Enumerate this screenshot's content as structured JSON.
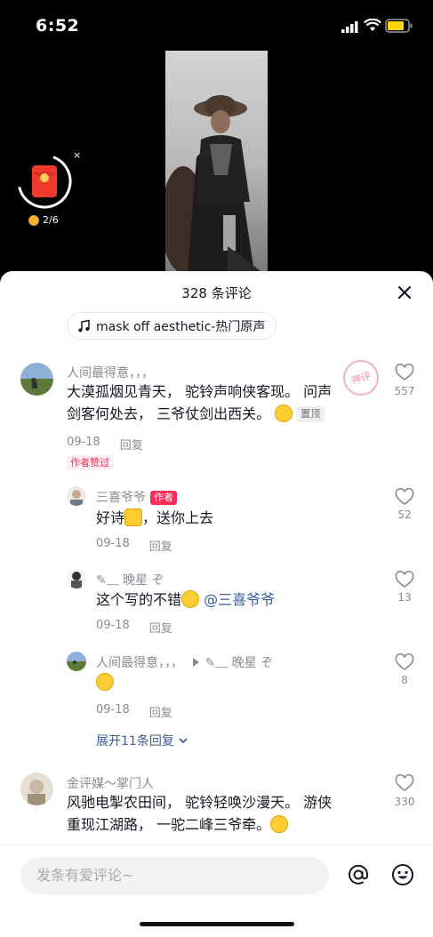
{
  "status_bar": {
    "time": "6:52"
  },
  "red_packet": {
    "count": "2/6",
    "close": "×"
  },
  "sheet": {
    "title": "328 条评论",
    "music_label": "mask off aesthetic-热门原声"
  },
  "comments": [
    {
      "user": "人间最得意，，，",
      "text_line1": "大漠孤烟见青天， 驼铃声响侠客现。 问声",
      "text_line2": "剑客何处去， 三爷仗剑出西关。",
      "pin_label": "置顶",
      "date": "09-18",
      "reply_label": "回复",
      "likes": "557",
      "author_liked": "作者赞过",
      "stamp": "神评"
    },
    {
      "user": "三喜爷爷",
      "author_tag": "作者",
      "text": "好诗",
      "text_after": "，送你上去",
      "date": "09-18",
      "reply_label": "回复",
      "likes": "52"
    },
    {
      "user": "✎﹏ 晚星 ぞ",
      "text": "这个写的不错",
      "mention": "@三喜爷爷",
      "date": "09-18",
      "reply_label": "回复",
      "likes": "13"
    },
    {
      "user": "人间最得意，，，",
      "reply_to": "✎﹏ 晚星 ぞ",
      "date": "09-18",
      "reply_label": "回复",
      "likes": "8"
    },
    {
      "user": "金评媒～掌门人",
      "text_line1": "风驰电掣农田间， 驼铃轻唤沙漫天。 游侠",
      "text_line2": "重现江湖路， 一驼二峰三爷牵。",
      "likes": "330"
    }
  ],
  "expand_replies": "展开11条回复",
  "input": {
    "placeholder": "发条有爱评论~"
  },
  "colors": {
    "accent": "#fe2c55",
    "link": "#3a5c9c",
    "muted": "#8a8b91"
  }
}
